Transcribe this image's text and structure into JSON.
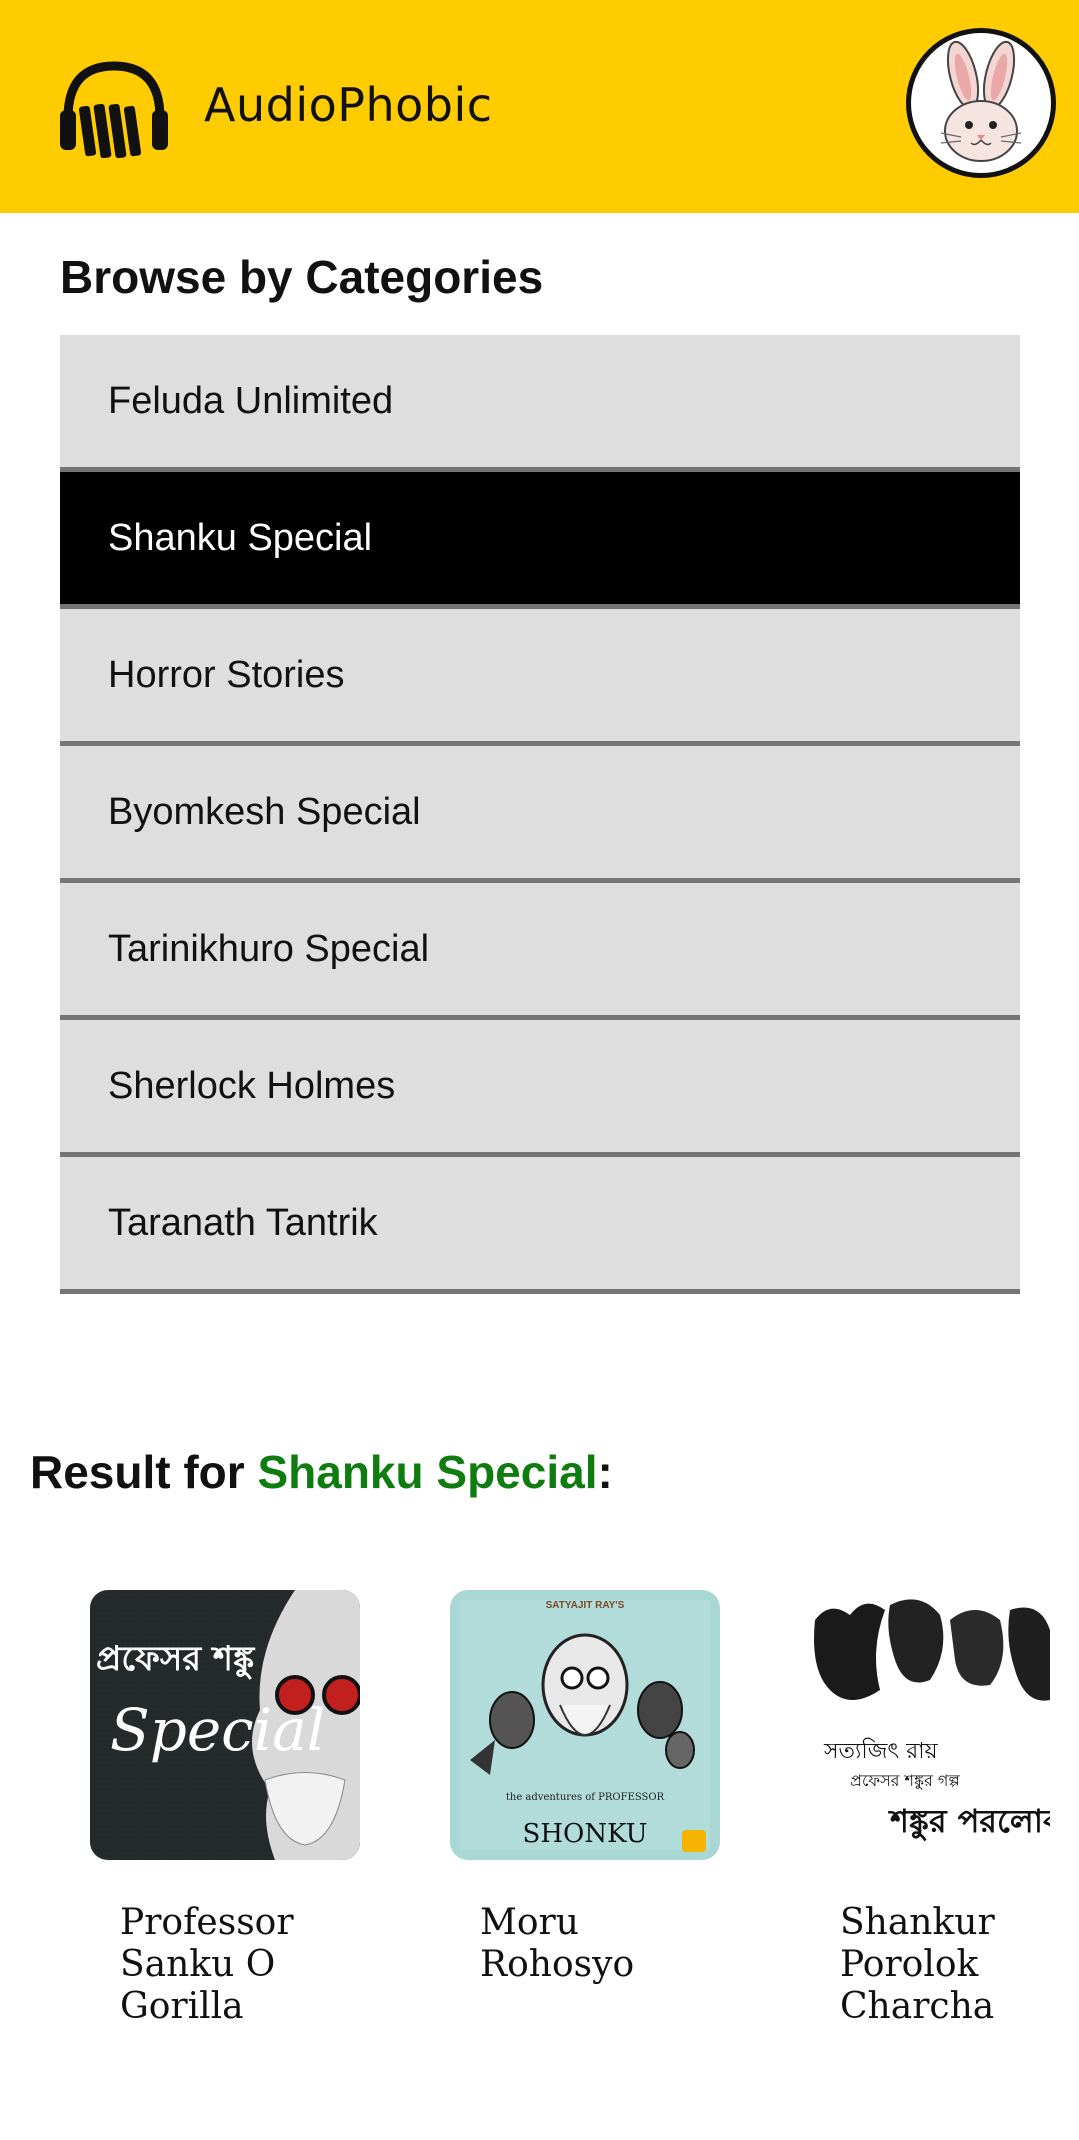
{
  "header": {
    "app_title": "AudioPhobic",
    "logo_icon": "headphones-icon",
    "avatar_icon": "rabbit-avatar",
    "background_color": "#FECC00"
  },
  "categories": {
    "title": "Browse by Categories",
    "items": [
      {
        "label": "Feluda Unlimited",
        "active": false
      },
      {
        "label": "Shanku Special",
        "active": true
      },
      {
        "label": "Horror Stories",
        "active": false
      },
      {
        "label": "Byomkesh Special",
        "active": false
      },
      {
        "label": "Tarinikhuro Special",
        "active": false
      },
      {
        "label": "Sherlock Holmes",
        "active": false
      },
      {
        "label": "Taranath Tantrik",
        "active": false
      }
    ],
    "item_color": "#DEDEDE",
    "active_color": "#000000"
  },
  "results": {
    "prefix": "Result for ",
    "selected_category": "Shanku Special",
    "suffix": ":",
    "highlight_color": "#0E7C0E",
    "items": [
      {
        "title": "Professor Sanku O Gorilla",
        "thumb_label_top": "প্রফেসর শঙ্কু",
        "thumb_label_main": "Special"
      },
      {
        "title": "Moru Rohosyo",
        "thumb_label_top": "SATYAJIT RAY'S",
        "thumb_label_main": "SHONKU",
        "thumb_label_sub": "the adventures of PROFESSOR"
      },
      {
        "title": "Shankur Porolok Charcha",
        "thumb_label_top": "সত্যজিৎ রায়",
        "thumb_label_sub": "প্রফেসর শঙ্কুর গল্প",
        "thumb_label_main": "শঙ্কুর পরলোকচ"
      }
    ]
  }
}
